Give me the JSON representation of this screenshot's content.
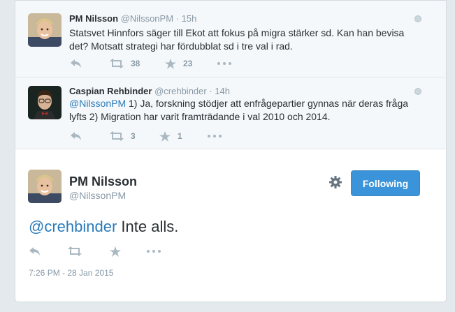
{
  "tweets": [
    {
      "fullname": "PM Nilsson",
      "handle": "@NilssonPM",
      "separator": "·",
      "time": "15h",
      "text": "Statsvet Hinnfors säger till Ekot att fokus på migra stärker sd. Kan han bevisa det? Motsatt strategi har fördubblat sd i tre val i rad.",
      "retweets": "38",
      "favorites": "23"
    },
    {
      "fullname": "Caspian Rehbinder",
      "handle": "@crehbinder",
      "separator": "·",
      "time": "14h",
      "mention": "@NilssonPM",
      "text": " 1) Ja, forskning stödjer att enfrågepartier gynnas när deras fråga lyfts 2) Migration har varit framträdande i val 2010 och 2014.",
      "retweets": "3",
      "favorites": "1"
    }
  ],
  "main_tweet": {
    "fullname": "PM Nilsson",
    "handle": "@NilssonPM",
    "follow_label": "Following",
    "mention": "@crehbinder",
    "text": " Inte alls.",
    "timestamp": "7:26 PM - 28 Jan 2015"
  },
  "icons": {
    "reply": "reply-icon",
    "retweet": "retweet-icon",
    "favorite": "star-icon",
    "more": "more-icon",
    "gear": "gear-icon",
    "globe": "globe-icon"
  },
  "colors": {
    "link": "#2b7bb9",
    "button": "#3b94d9",
    "muted": "#8899a6",
    "action_icon": "#aab8c2"
  }
}
